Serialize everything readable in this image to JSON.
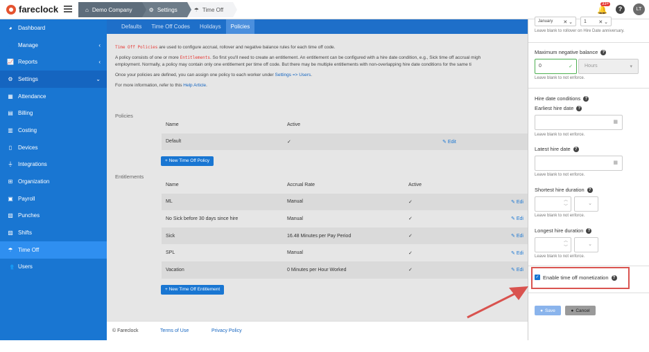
{
  "app": {
    "name": "fareclock"
  },
  "breadcrumbs": [
    "Demo Company",
    "Settings",
    "Time Off"
  ],
  "top": {
    "notif_count": "33+",
    "avatar": "LT",
    "help": "?"
  },
  "sidebar": {
    "items": [
      {
        "label": "Dashboard",
        "icon": "dashboard-icon",
        "glyph": "◕"
      },
      {
        "label": "Manage",
        "icon": "person-icon",
        "glyph": "👤",
        "chev": "‹"
      },
      {
        "label": "Reports",
        "icon": "chart-icon",
        "glyph": "📈",
        "chev": "‹"
      },
      {
        "label": "Settings",
        "icon": "gear-icon",
        "glyph": "⚙",
        "chev": "⌄"
      },
      {
        "label": "Attendance",
        "icon": "calendar-icon",
        "glyph": "▦"
      },
      {
        "label": "Billing",
        "icon": "billing-icon",
        "glyph": "▤"
      },
      {
        "label": "Costing",
        "icon": "costing-icon",
        "glyph": "▥"
      },
      {
        "label": "Devices",
        "icon": "device-icon",
        "glyph": "▯"
      },
      {
        "label": "Integrations",
        "icon": "plug-icon",
        "glyph": "⏚"
      },
      {
        "label": "Organization",
        "icon": "org-icon",
        "glyph": "⊞"
      },
      {
        "label": "Payroll",
        "icon": "payroll-icon",
        "glyph": "▣"
      },
      {
        "label": "Punches",
        "icon": "punch-icon",
        "glyph": "▧"
      },
      {
        "label": "Shifts",
        "icon": "shift-icon",
        "glyph": "▨"
      },
      {
        "label": "Time Off",
        "icon": "umbrella-icon",
        "glyph": "☂"
      },
      {
        "label": "Users",
        "icon": "users-icon",
        "glyph": "👥"
      }
    ],
    "collapse": "‹"
  },
  "tabs": [
    "Defaults",
    "Time Off Codes",
    "Holidays",
    "Policies"
  ],
  "intro": {
    "p1_code": "Time Off Policies",
    "p1_rest": " are used to configure accrual, rollover and negative balance rules for each time off code.",
    "p2_a": "A policy consists of one or more ",
    "p2_code": "Entitlements",
    "p2_b": ". So first you'll need to create an entitlement. An entitlement can be configured with a hire date condition, e.g., Sick time off accrual migh",
    "p2_c": "employment. Normally, a policy may contain only one entitlement per time off code. But there may be multiple entitlements with non-overlapping hire date conditions for the same ti",
    "p3_a": "Once your policies are defined, you can assign one policy to each worker under ",
    "p3_link": "Settings => Users",
    "p3_b": ".",
    "p4_a": "For more information, refer to this ",
    "p4_link": "Help Article",
    "p4_b": "."
  },
  "policies": {
    "label": "Policies",
    "headers": [
      "Name",
      "Active"
    ],
    "rows": [
      {
        "name": "Default",
        "active": "✓",
        "edit": "Edit"
      }
    ],
    "new_button": "+ New Time Off Policy"
  },
  "entitlements": {
    "label": "Entitlements",
    "headers": [
      "Name",
      "Accrual Rate",
      "Active"
    ],
    "rows": [
      {
        "name": "ML",
        "rate": "Manual",
        "active": "✓",
        "edit": "Edi"
      },
      {
        "name": "No Sick before 30 days since hire",
        "rate": "Manual",
        "active": "✓",
        "edit": "Edi"
      },
      {
        "name": "Sick",
        "rate": "16.48 Minutes per Pay Period",
        "active": "✓",
        "edit": "Edi"
      },
      {
        "name": "SPL",
        "rate": "Manual",
        "active": "✓",
        "edit": "Edi"
      },
      {
        "name": "Vacation",
        "rate": "0 Minutes per Hour Worked",
        "active": "✓",
        "edit": "Edi"
      }
    ],
    "new_button": "+ New Time Off Entitlement"
  },
  "footer": {
    "copyright": "© Fareclock",
    "terms": "Terms of Use",
    "privacy": "Privacy Policy"
  },
  "panel": {
    "rollover_month": "January",
    "rollover_day": "1",
    "rollover_hint": "Leave blank to rollover on Hire Date anniversary.",
    "max_neg_label": "Maximum negative balance",
    "max_neg_value": "0",
    "max_neg_unit": "Hours",
    "not_enforce": "Leave blank to not enforce.",
    "hire_conditions": "Hire date conditions",
    "earliest": "Earliest hire date",
    "latest": "Latest hire date",
    "shortest": "Shortest hire duration",
    "longest": "Longest hire duration",
    "monetization": "Enable time off monetization",
    "save": "Save",
    "cancel": "Cancel"
  },
  "colors": {
    "sidebar": "#1976d2",
    "active": "#2f8ff0",
    "highlight": "#d9534f"
  }
}
